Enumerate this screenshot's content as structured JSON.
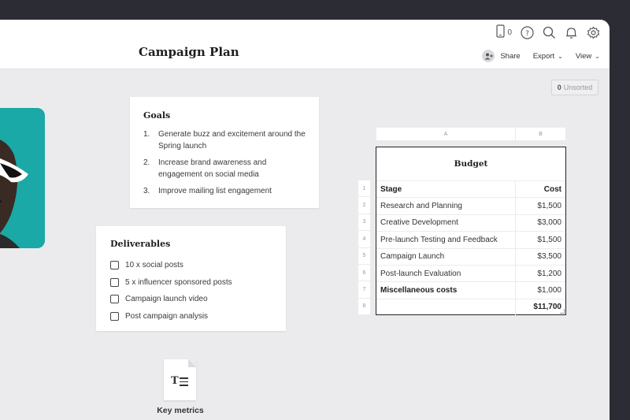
{
  "header": {
    "title": "Campaign Plan",
    "device_count": "0",
    "share_label": "Share",
    "export_label": "Export",
    "view_label": "View"
  },
  "icons": [
    "device-icon",
    "help-icon",
    "search-icon",
    "bell-icon",
    "settings-icon",
    "add-person-icon",
    "document-icon"
  ],
  "unsorted": {
    "count": "0",
    "label": "Unsorted"
  },
  "goals": {
    "title": "Goals",
    "items": [
      {
        "num": "1.",
        "text": "Generate buzz and excitement around the Spring launch"
      },
      {
        "num": "2.",
        "text": "Increase brand awareness and engagement on social media"
      },
      {
        "num": "3.",
        "text": "Improve mailing list engagement"
      }
    ]
  },
  "deliverables": {
    "title": "Deliverables",
    "items": [
      "10 x social posts",
      "5 x influencer sponsored posts",
      "Campaign launch video",
      "Post campaign analysis"
    ]
  },
  "budget": {
    "column_letters": [
      "A",
      "B"
    ],
    "row_numbers": [
      "1",
      "2",
      "3",
      "4",
      "5",
      "6",
      "7",
      "8"
    ],
    "title": "Budget",
    "header": {
      "stage": "Stage",
      "cost": "Cost"
    },
    "rows": [
      {
        "stage": "Research and Planning",
        "cost": "$1,500"
      },
      {
        "stage": "Creative Development",
        "cost": "$3,000"
      },
      {
        "stage": "Pre-launch Testing and Feedback",
        "cost": "$1,500"
      },
      {
        "stage": "Campaign Launch",
        "cost": "$3,500"
      },
      {
        "stage": "Post-launch Evaluation",
        "cost": "$1,200"
      },
      {
        "stage": "Miscellaneous costs",
        "cost": "$1,000"
      }
    ],
    "total": {
      "stage": "",
      "cost": "$11,700"
    }
  },
  "file": {
    "label": "Key metrics",
    "glyph": "T"
  },
  "colors": {
    "photo_bg": "#1aa9a6",
    "window_bg": "#ebebed",
    "frame": "#2c2c34"
  }
}
